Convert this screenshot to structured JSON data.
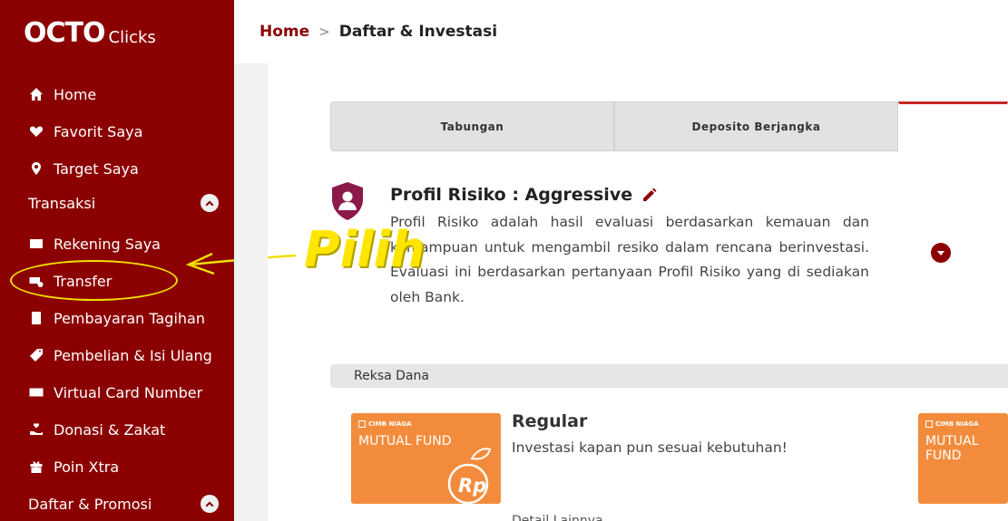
{
  "app": {
    "logo_main": "OCTO",
    "logo_sub": "Clicks"
  },
  "sidebar": {
    "items": [
      {
        "label": "Home",
        "icon": "home-icon"
      },
      {
        "label": "Favorit Saya",
        "icon": "heart-icon"
      },
      {
        "label": "Target Saya",
        "icon": "location-pin-icon"
      }
    ],
    "transaksi": {
      "label": "Transaksi",
      "items": [
        {
          "label": "Rekening Saya",
          "icon": "card-icon"
        },
        {
          "label": "Transfer",
          "icon": "transfer-icon"
        },
        {
          "label": "Pembayaran Tagihan",
          "icon": "bill-icon"
        },
        {
          "label": "Pembelian & Isi Ulang",
          "icon": "tag-icon"
        },
        {
          "label": "Virtual Card Number",
          "icon": "vcn-icon"
        },
        {
          "label": "Donasi & Zakat",
          "icon": "donation-icon"
        },
        {
          "label": "Poin Xtra",
          "icon": "gift-icon"
        }
      ]
    },
    "daftar": {
      "label": "Daftar & Promosi"
    }
  },
  "annotation": {
    "text": "Pilih",
    "color": "#ffe600"
  },
  "breadcrumb": {
    "home": "Home",
    "separator": ">",
    "current": "Daftar & Investasi"
  },
  "tabs": [
    {
      "label": "Tabungan"
    },
    {
      "label": "Deposito Berjangka"
    },
    {
      "label": ""
    }
  ],
  "risk_profile": {
    "title": "Profil Risiko : Aggressive",
    "description": "Profil Risiko adalah hasil evaluasi berdasarkan kemauan dan kemampuan untuk mengambil resiko dalam rencana berinvestasi. Evaluasi ini berdasarkan pertanyaan Profil Risiko yang di sediakan oleh Bank."
  },
  "reksa_dana": {
    "section_label": "Reksa Dana",
    "cards": [
      {
        "brand": "CIMB NIAGA",
        "label": "MUTUAL FUND"
      },
      {
        "brand": "CIMB NIAGA",
        "label": "MUTUAL FUND"
      }
    ],
    "regular": {
      "title": "Regular",
      "description": "Investasi kapan pun sesuai kebutuhan!",
      "cut_text": "Detail Lainnya"
    }
  },
  "colors": {
    "brand": "#8b0000",
    "accent": "#c62828",
    "fund_orange": "#f28c3c"
  }
}
